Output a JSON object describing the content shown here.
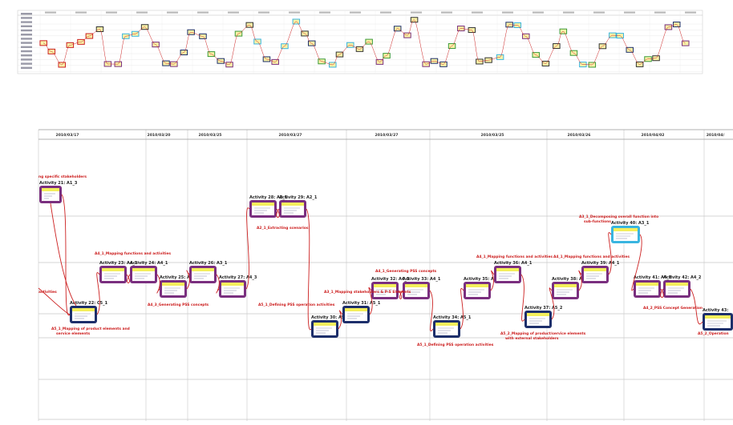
{
  "colors": {
    "link": "#cc2020",
    "frame_purple": "#7a2f7f",
    "frame_navy": "#1d2f6b",
    "frame_cyan": "#39b5e0",
    "frame_green": "#3a9a3a",
    "screen_yellow": "#f4ef5c",
    "grid": "#c9c9c9"
  },
  "timeline": {
    "dates": [
      "2010/03/17",
      "2010/03/20",
      "2010/03/25",
      "2010/03/27",
      "2010/03/27",
      "2010/03/25",
      "2010/03/26",
      "2010/04/02",
      "2010/04/"
    ]
  },
  "activities": [
    {
      "label": "Activity 21: A1_3",
      "frame": "purple"
    },
    {
      "label": "Activity 22: C5_1",
      "frame": "navy"
    },
    {
      "label": "Activity 23: A4_1",
      "frame": "purple"
    },
    {
      "label": "Activity 24: A4_1",
      "frame": "purple"
    },
    {
      "label": "Activity 25: A4_3",
      "frame": "purple"
    },
    {
      "label": "Activity 26: A3_1",
      "frame": "purple"
    },
    {
      "label": "Activity 27: A4_3",
      "frame": "purple"
    },
    {
      "label": "Activity 28: A2_1",
      "frame": "purple"
    },
    {
      "label": "Activity 29: A2_1",
      "frame": "purple"
    },
    {
      "label": "Activity 30: A5_1",
      "frame": "navy"
    },
    {
      "label": "Activity 31: A5_1",
      "frame": "navy"
    },
    {
      "label": "Activity 32: A4_1",
      "frame": "purple"
    },
    {
      "label": "Activity 33: A4_1",
      "frame": "purple"
    },
    {
      "label": "Activity 34: A5_1",
      "frame": "navy"
    },
    {
      "label": "Activity 35: A4_1",
      "frame": "purple"
    },
    {
      "label": "Activity 36: A4_1",
      "frame": "purple"
    },
    {
      "label": "Activity 37: A5_2",
      "frame": "navy"
    },
    {
      "label": "Activity 38: A4_1",
      "frame": "purple"
    },
    {
      "label": "Activity 39: A4_1",
      "frame": "purple"
    },
    {
      "label": "Activity 40: A3_1",
      "frame": "cyan"
    },
    {
      "label": "Activity 41: A4_2",
      "frame": "purple"
    },
    {
      "label": "Activity 42: A4_2",
      "frame": "purple"
    },
    {
      "label": "Activity 43:",
      "frame": "navy"
    }
  ],
  "notes": [
    "ng specific stakeholders",
    "activities",
    "A5_1_Mapping of product elements and service elements",
    "A4_1_Mapping functions and activities",
    "A4_3_Generating PSS concepts",
    "A2_1_Extracting scenarios",
    "A5_1_Defining PSS operation activities",
    "A4_1_Generating PSS concepts",
    "A3_1_Mapping stakeholders & P-S Elements",
    "A5_1_Defining PSS operation activities",
    "A4_1_Mapping functions and activities",
    "A5_2_Mapping of product/service elements with external stakeholders",
    "A4_1_Mapping functions and activities",
    "A3_1_Decomposing overall function into sub-functions",
    "A4_2_PSS Concept Generation",
    "A5_2_Operation"
  ]
}
